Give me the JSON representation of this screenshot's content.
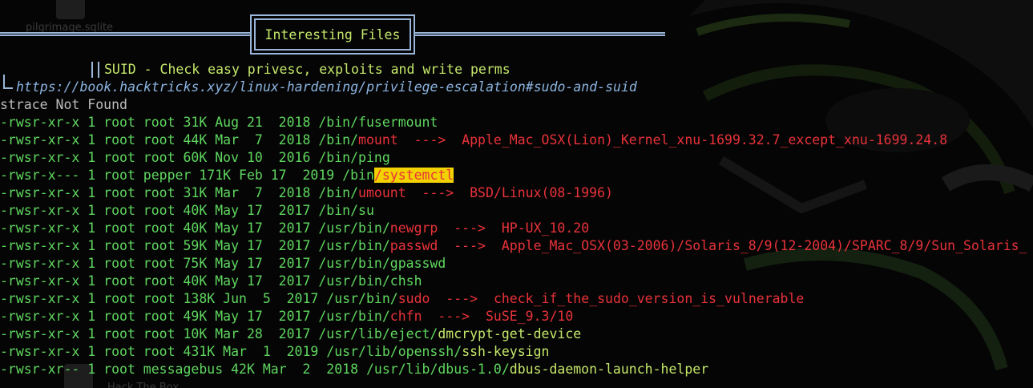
{
  "desktop": {
    "icon_labels": [
      "pilgrimage.sqlite",
      "Hack The Box"
    ]
  },
  "banner": {
    "title": "Interesting Files"
  },
  "section": {
    "heading": "SUID - Check easy privesc, exploits and write perms",
    "url": "https://book.hacktricks.xyz/linux-hardening/privilege-escalation#sudo-and-suid"
  },
  "strace_line": "strace Not Found",
  "suid_files": [
    {
      "meta": "-rwsr-xr-x 1 root root 31K Aug 21  2018 ",
      "dir": "/bin/",
      "name": "fusermount",
      "name_color": "green",
      "exploit": ""
    },
    {
      "meta": "-rwsr-xr-x 1 root root 44K Mar  7  2018 ",
      "dir": "/bin/",
      "name": "mount",
      "name_color": "red",
      "exploit": "Apple_Mac_OSX(Lion)_Kernel_xnu-1699.32.7_except_xnu-1699.24.8"
    },
    {
      "meta": "-rwsr-xr-x 1 root root 60K Nov 10  2016 ",
      "dir": "/bin/",
      "name": "ping",
      "name_color": "green",
      "exploit": ""
    },
    {
      "meta": "-rwsr-x--- 1 root pepper 171K Feb 17  2019 ",
      "dir": "/bin",
      "name": "/systemctl",
      "name_color": "highlight",
      "exploit": ""
    },
    {
      "meta": "-rwsr-xr-x 1 root root 31K Mar  7  2018 ",
      "dir": "/bin/",
      "name": "umount",
      "name_color": "red",
      "exploit": "BSD/Linux(08-1996)"
    },
    {
      "meta": "-rwsr-xr-x 1 root root 40K May 17  2017 ",
      "dir": "/bin/",
      "name": "su",
      "name_color": "green",
      "exploit": ""
    },
    {
      "meta": "-rwsr-xr-x 1 root root 40K May 17  2017 ",
      "dir": "/usr/bin/",
      "name": "newgrp",
      "name_color": "red",
      "exploit": "HP-UX_10.20"
    },
    {
      "meta": "-rwsr-xr-x 1 root root 59K May 17  2017 ",
      "dir": "/usr/bin/",
      "name": "passwd",
      "name_color": "red",
      "exploit": "Apple_Mac_OSX(03-2006)/Solaris_8/9(12-2004)/SPARC_8/9/Sun_Solaris_"
    },
    {
      "meta": "-rwsr-xr-x 1 root root 75K May 17  2017 ",
      "dir": "/usr/bin/",
      "name": "gpasswd",
      "name_color": "green",
      "exploit": ""
    },
    {
      "meta": "-rwsr-xr-x 1 root root 40K May 17  2017 ",
      "dir": "/usr/bin/",
      "name": "chsh",
      "name_color": "green",
      "exploit": ""
    },
    {
      "meta": "-rwsr-xr-x 1 root root 138K Jun  5  2017 ",
      "dir": "/usr/bin/",
      "name": "sudo",
      "name_color": "red",
      "exploit": "check_if_the_sudo_version_is_vulnerable"
    },
    {
      "meta": "-rwsr-xr-x 1 root root 49K May 17  2017 ",
      "dir": "/usr/bin/",
      "name": "chfn",
      "name_color": "red",
      "exploit": "SuSE_9.3/10"
    },
    {
      "meta": "-rwsr-xr-x 1 root root 10K Mar 28  2017 ",
      "dir": "/usr/lib/eject/",
      "name": "dmcrypt-get-device",
      "name_color": "yellow",
      "exploit": ""
    },
    {
      "meta": "-rwsr-xr-x 1 root root 431K Mar  1  2019 ",
      "dir": "/usr/lib/openssh/",
      "name": "ssh-keysign",
      "name_color": "yellow",
      "exploit": ""
    },
    {
      "meta": "-rwsr-xr-- 1 root messagebus 42K Mar  2  2018 ",
      "dir": "/usr/lib/dbus-1.0/",
      "name": "dbus-daemon-launch-helper",
      "name_color": "yellow",
      "exploit": ""
    }
  ],
  "arrow": "  --->  ",
  "colors": {
    "background": "#050505",
    "green": "#5fd75f",
    "yellow": "#c5e86a",
    "red": "#e8323a",
    "url": "#8cb4e0",
    "highlight_bg": "#f2d300",
    "border": "#9ab6d8"
  }
}
